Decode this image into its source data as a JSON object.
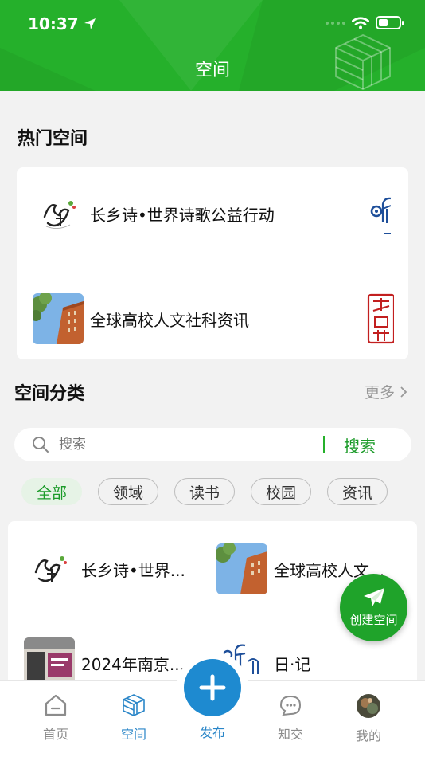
{
  "status_bar": {
    "time": "10:37"
  },
  "header": {
    "title": "空间"
  },
  "hot_section": {
    "title": "热门空间",
    "items": [
      {
        "name": "长乡诗•世界诗歌公益行动",
        "logo_icon": "changxiangshi-logo"
      },
      {
        "name": "全球高校人文社科资讯",
        "logo_icon": "campus-building-photo"
      }
    ]
  },
  "category_section": {
    "title": "空间分类",
    "more_label": "更多"
  },
  "search": {
    "placeholder": "搜索",
    "button_label": "搜索"
  },
  "chips": [
    "全部",
    "领域",
    "读书",
    "校园",
    "资讯"
  ],
  "spaces": [
    {
      "name": "长乡诗•世界...",
      "logo_icon": "changxiangshi-logo"
    },
    {
      "name": "全球高校人文...",
      "logo_icon": "campus-building-photo"
    },
    {
      "name": "2024年南京...",
      "logo_icon": "storefront-photo"
    },
    {
      "name": "日·记",
      "logo_icon": "calligraphy-logo"
    }
  ],
  "fab": {
    "label": "创建空间"
  },
  "tabbar": {
    "items": [
      {
        "label": "首页",
        "icon": "home-icon"
      },
      {
        "label": "空间",
        "icon": "cube-icon"
      },
      {
        "label": "发布",
        "icon": "plus-icon"
      },
      {
        "label": "知交",
        "icon": "chat-heart-icon"
      },
      {
        "label": "我的",
        "icon": "avatar"
      }
    ]
  },
  "colors": {
    "brand_green": "#25b02b",
    "tab_active": "#2a86c8",
    "publish_blue": "#1e8ad0"
  }
}
